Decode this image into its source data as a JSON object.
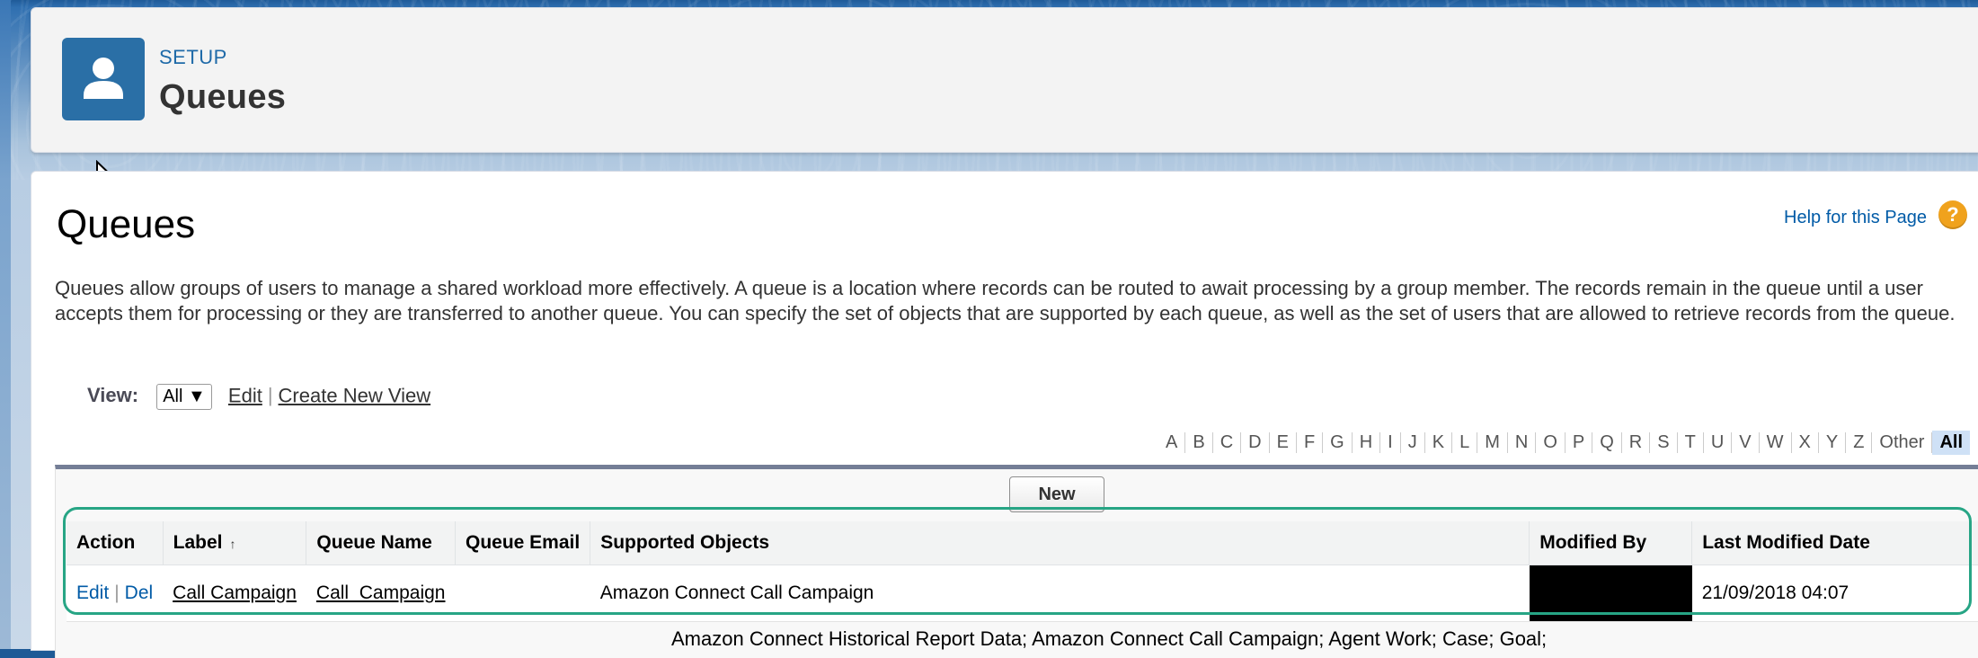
{
  "header": {
    "eyebrow": "SETUP",
    "title": "Queues",
    "icon": "user-icon"
  },
  "page": {
    "title": "Queues",
    "help_link": "Help for this Page",
    "help_icon_glyph": "?",
    "description": "Queues allow groups of users to manage a shared workload more effectively. A queue is a location where records can be routed to await processing by a group member. The records remain in the queue until a user accepts them for processing or they are transferred to another queue. You can specify the set of objects that are supported by each queue, as well as the set of users that are allowed to retrieve records from the queue."
  },
  "view": {
    "label": "View:",
    "selected": "All",
    "edit": "Edit",
    "create_new": "Create New View",
    "sep": "|"
  },
  "alphabet": [
    "A",
    "B",
    "C",
    "D",
    "E",
    "F",
    "G",
    "H",
    "I",
    "J",
    "K",
    "L",
    "M",
    "N",
    "O",
    "P",
    "Q",
    "R",
    "S",
    "T",
    "U",
    "V",
    "W",
    "X",
    "Y",
    "Z",
    "Other",
    "All"
  ],
  "alphabet_active": "All",
  "list": {
    "new_button": "New",
    "columns": [
      "Action",
      "Label",
      "Queue Name",
      "Queue Email",
      "Supported Objects",
      "Modified By",
      "Last Modified Date"
    ],
    "sort_glyph": "↑",
    "rows": [
      {
        "edit": "Edit",
        "sep": "|",
        "del": "Del",
        "label": "Call Campaign",
        "queue_name": "Call_Campaign",
        "queue_email": "",
        "supported_objects": "Amazon Connect Call Campaign",
        "modified_by": "",
        "last_modified": "21/09/2018 04:07"
      }
    ],
    "next_row_objects": "Amazon Connect Historical Report Data; Amazon Connect Call Campaign; Agent Work; Case; Goal;"
  },
  "colors": {
    "accent": "#015ba7",
    "highlight": "#27a585",
    "help": "#f0a21d",
    "icon_bg": "#2a6fa6"
  }
}
